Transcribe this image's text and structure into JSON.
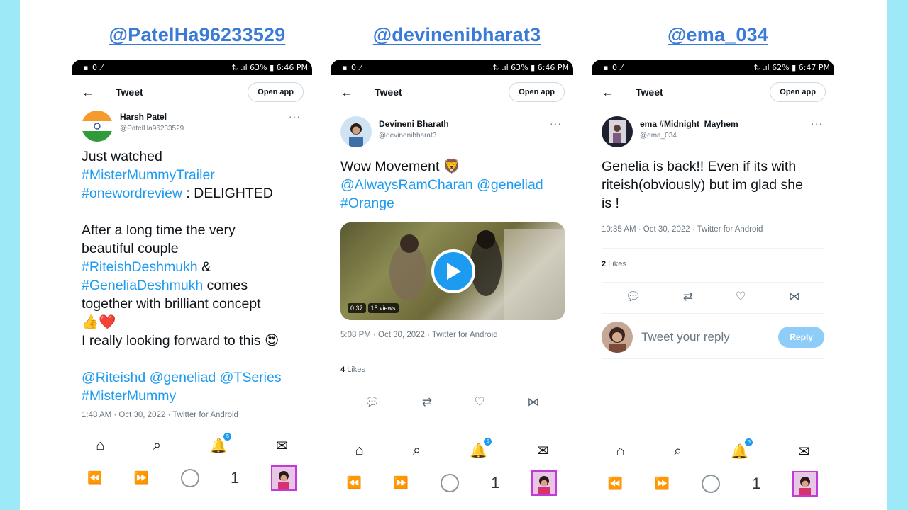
{
  "colors": {
    "frame": "#9ee9f7",
    "link": "#1d9bf0",
    "handle": "#3b7bd8"
  },
  "panels": [
    {
      "caption": "@PatelHa96233529",
      "status": {
        "left": "▪ 0 ⁄",
        "right": "⇅ .ıl 63% ▮ 6:46 PM"
      },
      "title": "Tweet",
      "open_app": "Open app",
      "author_name": "Harsh Patel",
      "author_handle": "@PatelHa96233529",
      "text_lines": [
        "Just watched"
      ],
      "text_tag1": "#MisterMummyTrailer",
      "text_tag2": "#onewordreview",
      "text_after_tag2": " : DELIGHTED",
      "p2_line1": "After a long time the very",
      "p2_line2": "beautiful couple",
      "p2_tag1": "#RiteishDeshmukh",
      "p2_amp": " &",
      "p2_tag2": "#GeneliaDeshmukh",
      "p2_after": " comes",
      "p2_line3": "together with brilliant concept",
      "p2_emoji": "👍❤️",
      "p2_line4": "I really looking forward to this 😍",
      "mentions": "@Riteishd @geneliad @TSeries",
      "final_tag": "#MisterMummy",
      "meta": "1:48 AM · Oct 30, 2022 · Twitter for Android",
      "tabs_count": "1",
      "notif_badge": "5"
    },
    {
      "caption": "@devinenibharat3",
      "status": {
        "left": "▪ 0 ⁄",
        "right": "⇅ .ıl 63% ▮ 6:46 PM"
      },
      "title": "Tweet",
      "open_app": "Open app",
      "author_name": "Devineni Bharath",
      "author_handle": "@devinenibharat3",
      "text_line1": "Wow Movement 🦁",
      "text_tags": "@AlwaysRamCharan @geneliad",
      "text_tag3": "#Orange",
      "video_time": "0:37",
      "video_views": "15 views",
      "meta": "5:08 PM · Oct 30, 2022 · Twitter for Android",
      "likes_count": "4",
      "likes_label": "Likes",
      "tabs_count": "1",
      "notif_badge": "5"
    },
    {
      "caption": "@ema_034",
      "status": {
        "left": "▪ 0 ⁄",
        "right": "⇅ .ıl 62% ▮ 6:47 PM"
      },
      "title": "Tweet",
      "open_app": "Open app",
      "author_name": "ema #Midnight_Mayhem",
      "author_handle": "@ema_034",
      "text_line1": "Genelia is back!! Even if its with",
      "text_line2": "riteish(obviously) but im glad she",
      "text_line3": "is !",
      "meta": "10:35 AM · Oct 30, 2022 · Twitter for Android",
      "likes_count": "2",
      "likes_label": "Likes",
      "reply_placeholder": "Tweet your reply",
      "reply_button": "Reply",
      "tabs_count": "1",
      "notif_badge": "5"
    }
  ]
}
